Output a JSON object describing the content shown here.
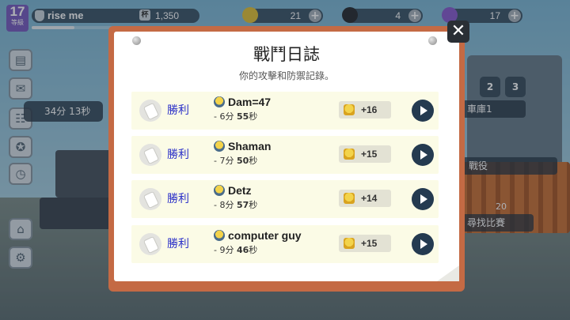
{
  "hud": {
    "level": "17",
    "level_caption": "等級",
    "player_name": "rise me",
    "trophies": "1,350",
    "trophy_glyph": "杯",
    "xp_fraction": 0.45,
    "resources": [
      {
        "name": "coins",
        "value": "21",
        "color": "#e2c23a",
        "plus": "+"
      },
      {
        "name": "bombs",
        "value": "4",
        "color": "#2b2f34",
        "plus": "+"
      },
      {
        "name": "gems",
        "value": "17",
        "color": "#8a5fd0",
        "plus": "+"
      }
    ]
  },
  "sidebar": {
    "timer": "34分 13秒",
    "buttons": [
      {
        "icon": "news-icon",
        "glyph": "▤"
      },
      {
        "icon": "mail-icon",
        "glyph": "✉"
      },
      {
        "icon": "clipboard-icon",
        "glyph": "☷"
      },
      {
        "icon": "medal-icon",
        "glyph": "✪"
      },
      {
        "icon": "clock-icon",
        "glyph": "◷"
      },
      {
        "icon": "shop-icon",
        "glyph": "⌂"
      },
      {
        "icon": "gear-icon",
        "glyph": "⚙"
      }
    ]
  },
  "right_panel": {
    "garage_tabs": [
      "2",
      "3"
    ],
    "garage_label": "車庫1",
    "campaign_label": "戰役",
    "find_match_label": "尋找比賽",
    "find_match_count": "20"
  },
  "modal": {
    "title": "戰鬥日誌",
    "subtitle": "你的攻擊和防禦記錄。",
    "close_label": "✕",
    "entries": [
      {
        "result": "勝利",
        "opponent": "Dam=47",
        "prefix": "- ",
        "minutes": "6",
        "min_unit": "分 ",
        "seconds": "55",
        "sec_unit": "秒",
        "trophies": "+16"
      },
      {
        "result": "勝利",
        "opponent": "Shaman",
        "prefix": "- ",
        "minutes": "7",
        "min_unit": "分 ",
        "seconds": "50",
        "sec_unit": "秒",
        "trophies": "+15"
      },
      {
        "result": "勝利",
        "opponent": "Detz",
        "prefix": "- ",
        "minutes": "8",
        "min_unit": "分 ",
        "seconds": "57",
        "sec_unit": "秒",
        "trophies": "+14"
      },
      {
        "result": "勝利",
        "opponent": "computer guy",
        "prefix": "- ",
        "minutes": "9",
        "min_unit": "分 ",
        "seconds": "46",
        "sec_unit": "秒",
        "trophies": "+15"
      }
    ]
  }
}
